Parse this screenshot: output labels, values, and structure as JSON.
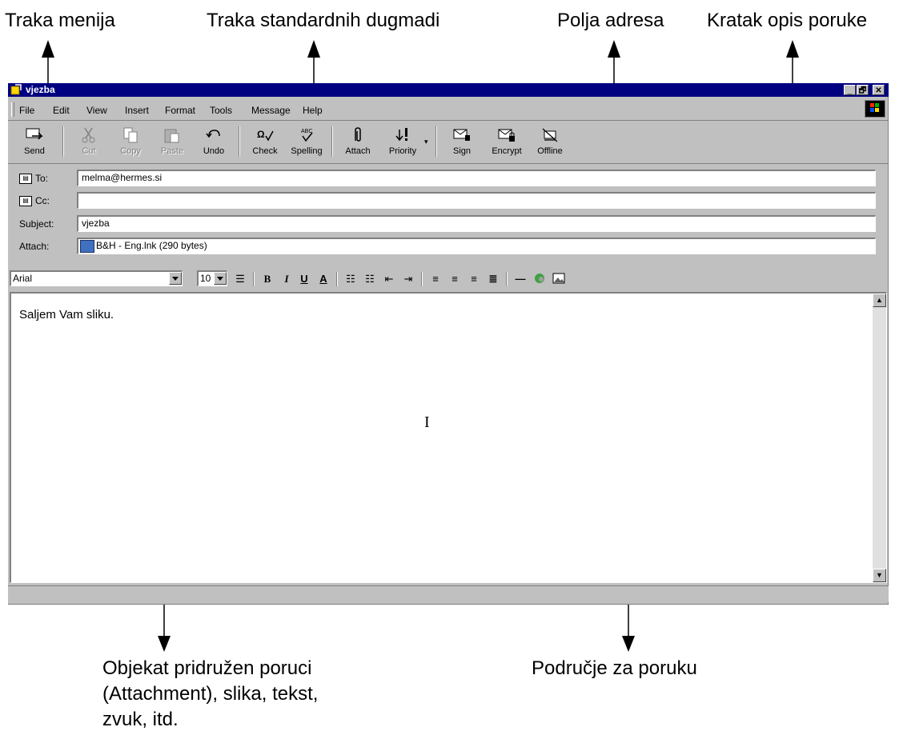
{
  "callouts": {
    "menu_bar": "Traka menija",
    "standard_buttons": "Traka standardnih dugmadi",
    "address_fields": "Polja adresa",
    "subject_desc": "Kratak opis poruke",
    "attachment_line1": "Objekat pridružen poruci",
    "attachment_line2": "(Attachment), slika, tekst,",
    "attachment_line3": "zvuk,  itd.",
    "message_area": "Područje za poruku"
  },
  "window": {
    "title": "vjezba",
    "controls": [
      "_",
      "🗗",
      "✕"
    ]
  },
  "menu": {
    "items": [
      "File",
      "Edit",
      "View",
      "Insert",
      "Format",
      "Tools",
      "Message",
      "Help"
    ]
  },
  "toolbar": {
    "buttons": [
      {
        "label": "Send",
        "icon": "send-icon",
        "enabled": true
      },
      {
        "label": "Cut",
        "icon": "cut-icon",
        "enabled": false
      },
      {
        "label": "Copy",
        "icon": "copy-icon",
        "enabled": false
      },
      {
        "label": "Paste",
        "icon": "paste-icon",
        "enabled": false
      },
      {
        "label": "Undo",
        "icon": "undo-icon",
        "enabled": true
      },
      {
        "label": "Check",
        "icon": "check-names-icon",
        "enabled": true
      },
      {
        "label": "Spelling",
        "icon": "spelling-icon",
        "enabled": true
      },
      {
        "label": "Attach",
        "icon": "paperclip-icon",
        "enabled": true
      },
      {
        "label": "Priority",
        "icon": "priority-icon",
        "enabled": true
      },
      {
        "label": "Sign",
        "icon": "sign-icon",
        "enabled": true
      },
      {
        "label": "Encrypt",
        "icon": "encrypt-icon",
        "enabled": true
      },
      {
        "label": "Offline",
        "icon": "offline-icon",
        "enabled": true
      }
    ]
  },
  "header": {
    "to_label": "To:",
    "to_value": "melma@hermes.si",
    "cc_label": "Cc:",
    "cc_value": "",
    "subject_label": "Subject:",
    "subject_value": "vjezba",
    "attach_label": "Attach:",
    "attach_value": "B&H - Eng.lnk (290 bytes)"
  },
  "format": {
    "font": "Arial",
    "size": "10"
  },
  "message": {
    "body": "Saljem Vam sliku."
  }
}
